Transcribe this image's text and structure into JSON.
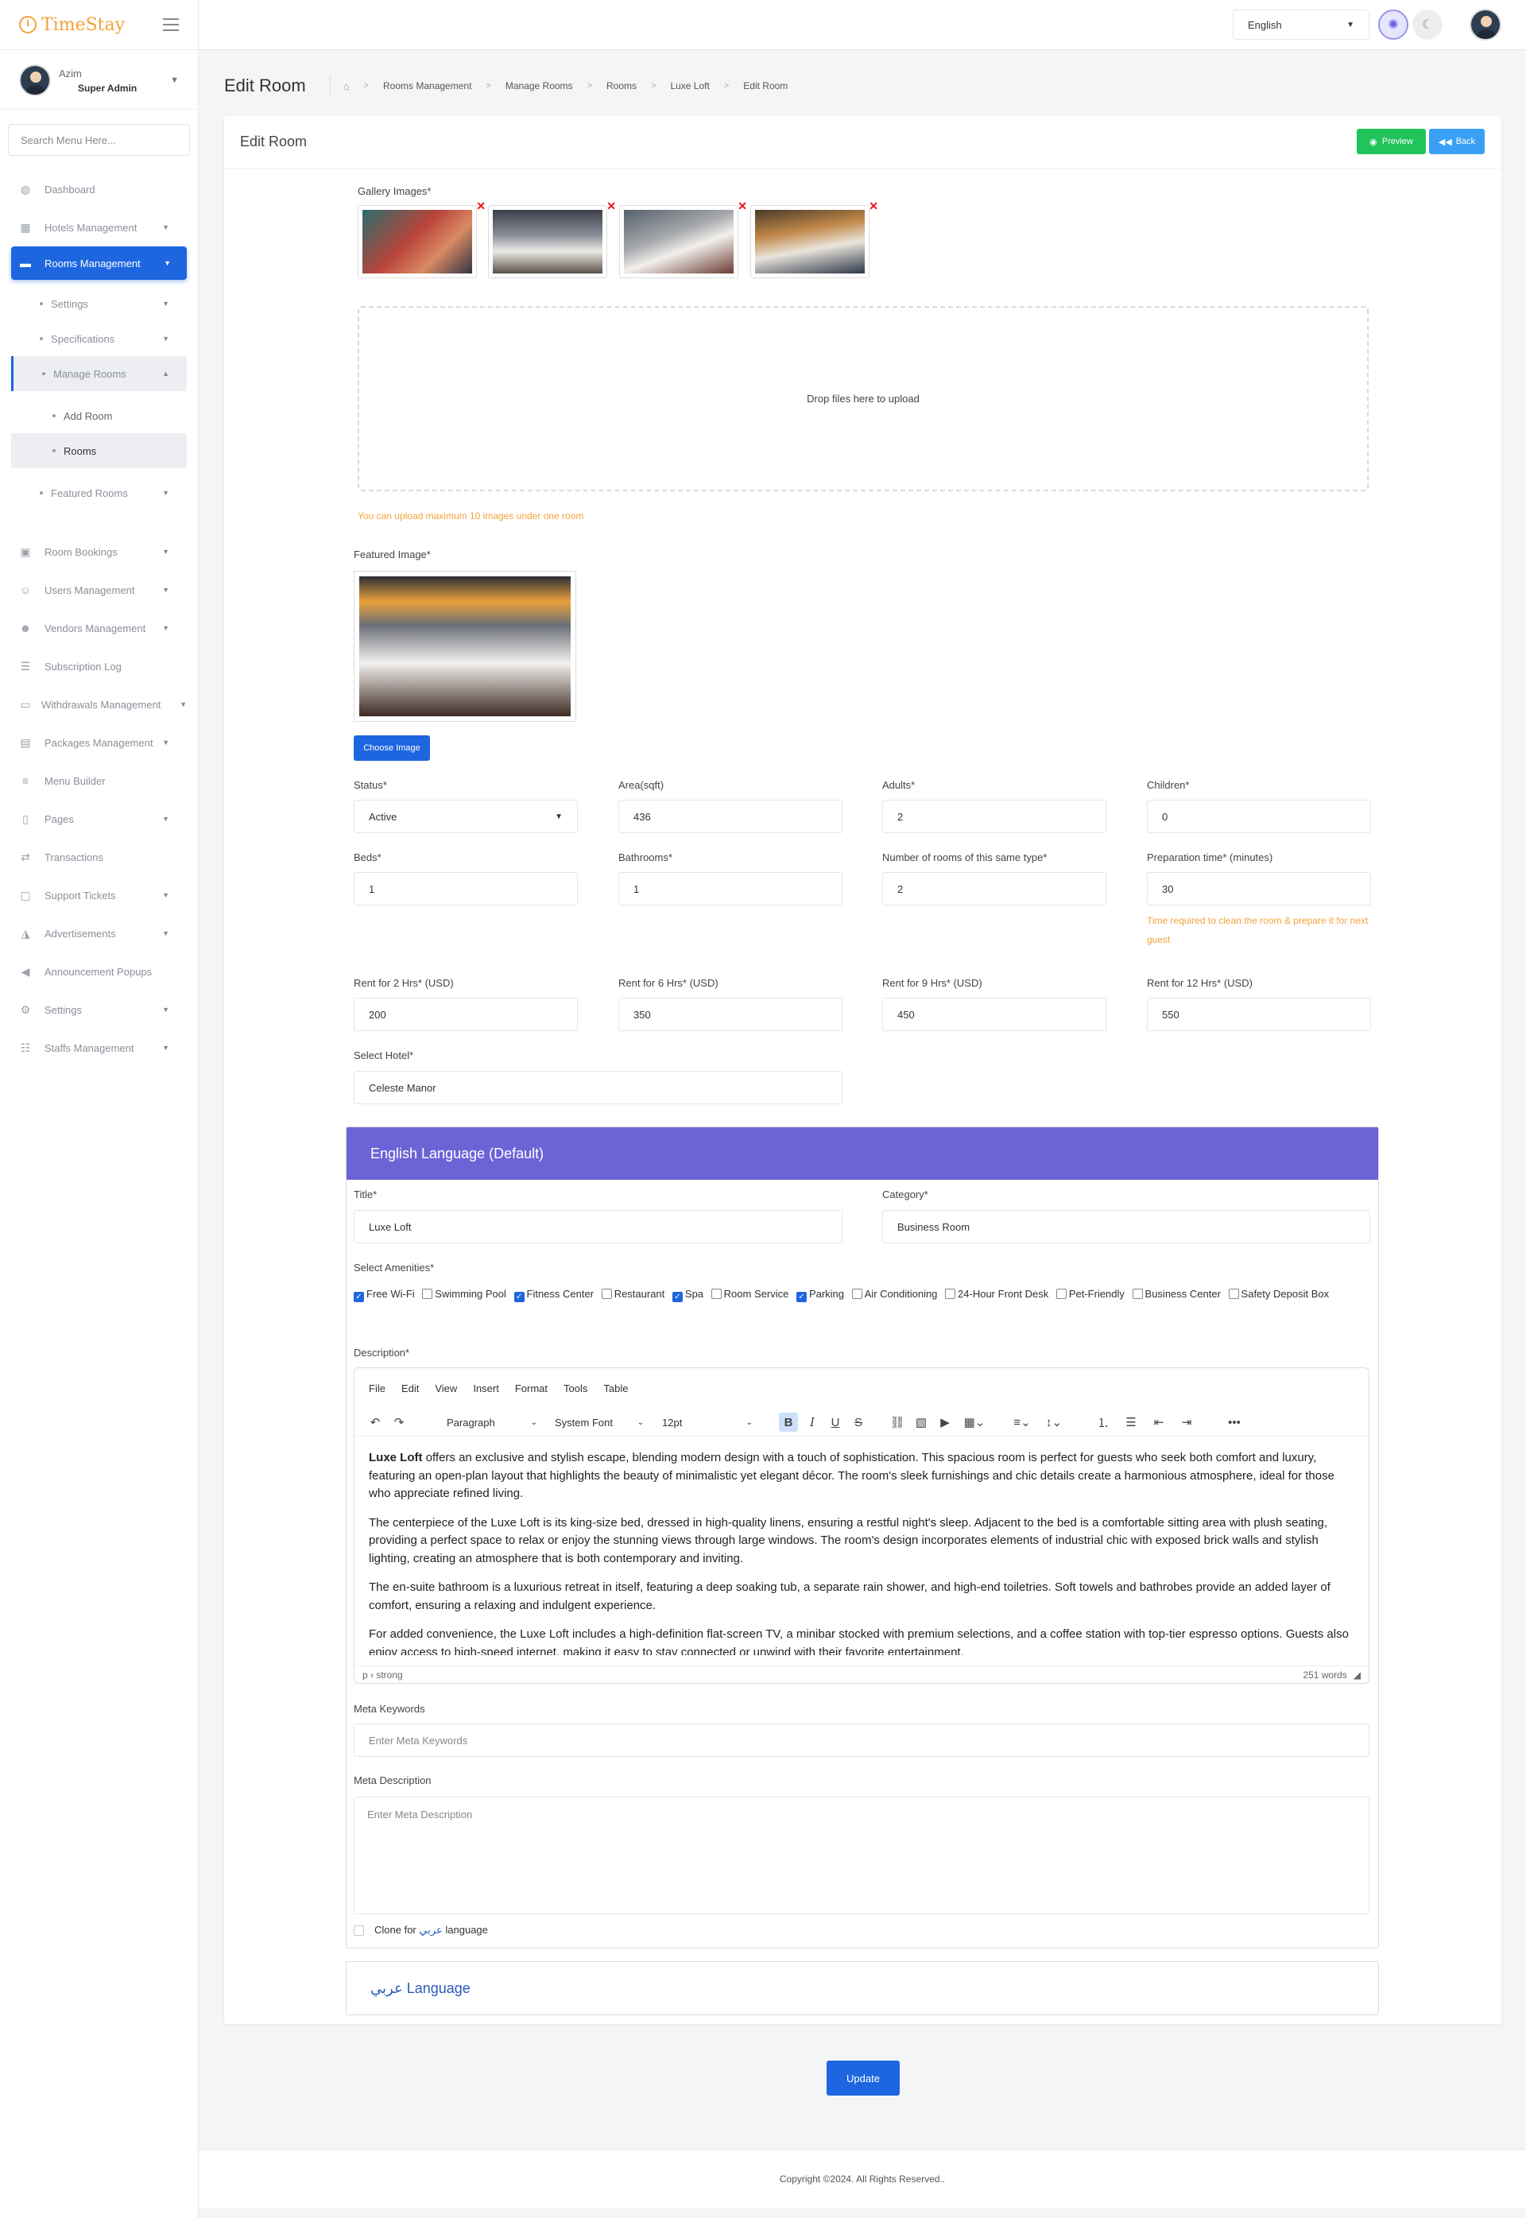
{
  "brand": {
    "name": "TimeStay"
  },
  "user": {
    "name": "Azim",
    "role": "Super Admin"
  },
  "sidebar": {
    "search_placeholder": "Search Menu Here...",
    "items": [
      {
        "label": "Dashboard",
        "icon": "palette-icon"
      },
      {
        "label": "Hotels Management",
        "icon": "building-icon"
      },
      {
        "label": "Rooms Management",
        "icon": "bed-icon"
      },
      {
        "label": "Settings"
      },
      {
        "label": "Specifications"
      },
      {
        "label": "Manage Rooms"
      },
      {
        "label": "Add Room"
      },
      {
        "label": "Rooms"
      },
      {
        "label": "Featured Rooms"
      },
      {
        "label": "Room Bookings",
        "icon": "calendar-check-icon"
      },
      {
        "label": "Users Management",
        "icon": "users-icon"
      },
      {
        "label": "Vendors Management",
        "icon": "user-tie-icon"
      },
      {
        "label": "Subscription Log",
        "icon": "list-icon"
      },
      {
        "label": "Withdrawals Management",
        "icon": "credit-card-icon"
      },
      {
        "label": "Packages Management",
        "icon": "receipt-icon"
      },
      {
        "label": "Menu Builder",
        "icon": "bars-icon"
      },
      {
        "label": "Pages",
        "icon": "file-icon"
      },
      {
        "label": "Transactions",
        "icon": "exchange-icon"
      },
      {
        "label": "Support Tickets",
        "icon": "ticket-icon"
      },
      {
        "label": "Advertisements",
        "icon": "ad-icon"
      },
      {
        "label": "Announcement Popups",
        "icon": "bullhorn-icon"
      },
      {
        "label": "Settings",
        "icon": "gear-icon"
      },
      {
        "label": "Staffs Management",
        "icon": "staff-icon"
      }
    ]
  },
  "topbar": {
    "language": "English"
  },
  "page": {
    "title": "Edit Room",
    "breadcrumb": [
      "Rooms Management",
      "Manage Rooms",
      "Rooms",
      "Luxe Loft",
      "Edit Room"
    ]
  },
  "card": {
    "title": "Edit Room",
    "preview_label": "Preview",
    "back_label": "Back"
  },
  "form": {
    "gallery_label": "Gallery Images*",
    "dropzone_text": "Drop files here to upload",
    "gallery_note": "You can upload maximum 10 images under one room",
    "featured_label": "Featured Image*",
    "choose_label": "Choose Image",
    "status_label": "Status*",
    "status_value": "Active",
    "area_label": "Area(sqft)",
    "area_value": "436",
    "adults_label": "Adults*",
    "adults_value": "2",
    "children_label": "Children*",
    "children_value": "0",
    "beds_label": "Beds*",
    "beds_value": "1",
    "bathrooms_label": "Bathrooms*",
    "bathrooms_value": "1",
    "rooms_count_label": "Number of rooms of this same type*",
    "rooms_count_value": "2",
    "prep_label": "Preparation time* (minutes)",
    "prep_value": "30",
    "prep_note": "Time required to clean the room & prepare it for next guest",
    "rent2_label": "Rent for 2 Hrs* (USD)",
    "rent2_value": "200",
    "rent6_label": "Rent for 6 Hrs* (USD)",
    "rent6_value": "350",
    "rent9_label": "Rent for 9 Hrs* (USD)",
    "rent9_value": "450",
    "rent12_label": "Rent for 12 Hrs* (USD)",
    "rent12_value": "550",
    "hotel_label": "Select Hotel*",
    "hotel_value": "Celeste Manor"
  },
  "english": {
    "heading": "English Language (Default)",
    "title_label": "Title*",
    "title_value": "Luxe Loft",
    "category_label": "Category*",
    "category_value": "Business Room",
    "amenities_label": "Select Amenities*",
    "amenities": [
      {
        "label": "Free Wi-Fi",
        "checked": true
      },
      {
        "label": "Swimming Pool",
        "checked": false
      },
      {
        "label": "Fitness Center",
        "checked": true
      },
      {
        "label": "Restaurant",
        "checked": false
      },
      {
        "label": "Spa",
        "checked": true
      },
      {
        "label": "Room Service",
        "checked": false
      },
      {
        "label": "Parking",
        "checked": true
      },
      {
        "label": "Air Conditioning",
        "checked": false
      },
      {
        "label": "24-Hour Front Desk",
        "checked": false
      },
      {
        "label": "Pet-Friendly",
        "checked": false
      },
      {
        "label": "Business Center",
        "checked": false
      },
      {
        "label": "Safety Deposit Box",
        "checked": false
      }
    ],
    "description_label": "Description*",
    "editor_menu": [
      "File",
      "Edit",
      "View",
      "Insert",
      "Format",
      "Tools",
      "Table"
    ],
    "block_format": "Paragraph",
    "font_family": "System Font",
    "font_size": "12pt",
    "desc_lead": "Luxe Loft",
    "desc_p1": " offers an exclusive and stylish escape, blending modern design with a touch of sophistication. This spacious room is perfect for guests who seek both comfort and luxury, featuring an open-plan layout that highlights the beauty of minimalistic yet elegant décor. The room's sleek furnishings and chic details create a harmonious atmosphere, ideal for those who appreciate refined living.",
    "desc_p2": "The centerpiece of the Luxe Loft is its king-size bed, dressed in high-quality linens, ensuring a restful night's sleep. Adjacent to the bed is a comfortable sitting area with plush seating, providing a perfect space to relax or enjoy the stunning views through large windows. The room's design incorporates elements of industrial chic with exposed brick walls and stylish lighting, creating an atmosphere that is both contemporary and inviting.",
    "desc_p3": "The en-suite bathroom is a luxurious retreat in itself, featuring a deep soaking tub, a separate rain shower, and high-end toiletries. Soft towels and bathrobes provide an added layer of comfort, ensuring a relaxing and indulgent experience.",
    "desc_p4": "For added convenience, the Luxe Loft includes a high-definition flat-screen TV, a minibar stocked with premium selections, and a coffee station with top-tier espresso options. Guests also enjoy access to high-speed internet, making it easy to stay connected or unwind with their favorite entertainment.",
    "editor_path": "p › strong",
    "word_count": "251 words",
    "meta_keywords_label": "Meta Keywords",
    "meta_keywords_placeholder": "Enter Meta Keywords",
    "meta_desc_label": "Meta Description",
    "meta_desc_placeholder": "Enter Meta Description",
    "clone_prefix": "Clone for",
    "clone_lang": "عربي",
    "clone_suffix": "language"
  },
  "arabic": {
    "name": "عربي",
    "suffix": "Language"
  },
  "update_label": "Update",
  "footer": "Copyright ©2024. All Rights Reserved.."
}
